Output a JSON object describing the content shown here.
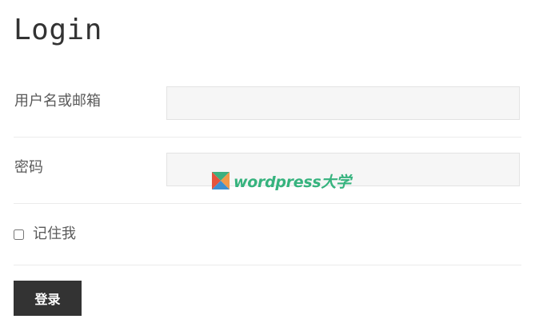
{
  "page": {
    "title": "Login"
  },
  "form": {
    "username_label": "用户名或邮箱",
    "username_value": "",
    "password_label": "密码",
    "password_value": "",
    "remember_label": "记住我",
    "remember_checked": false,
    "submit_label": "登录"
  },
  "watermark": {
    "text": "wordpress大学",
    "logo_icon": "wordpress-daxue-logo-icon",
    "colors": {
      "text": "#36b37e",
      "logo_green": "#3db07f",
      "logo_blue": "#3d8fd1",
      "logo_orange": "#f2994a",
      "logo_red": "#e5533d"
    }
  },
  "colors": {
    "button_bg": "#333333",
    "field_bg": "#f6f6f6",
    "divider": "#ebebeb"
  }
}
